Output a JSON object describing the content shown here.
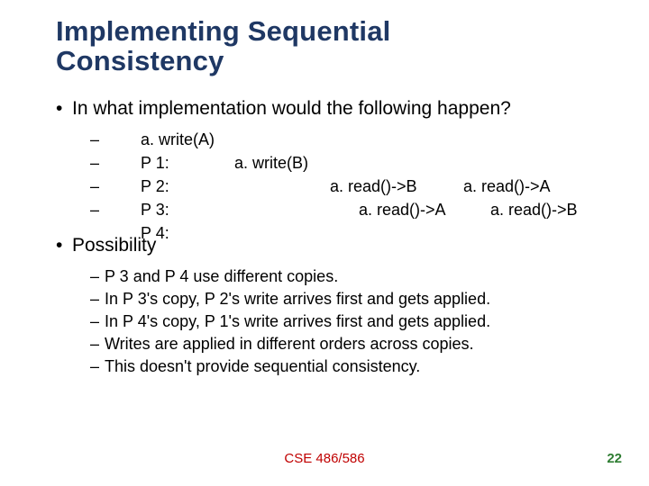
{
  "title_line1": "Implementing Sequential",
  "title_line2": "Consistency",
  "bullet1": "In what implementation would the following happen?",
  "procs": {
    "p1": {
      "label": "P 1:",
      "e0": "a. write(A)"
    },
    "p2": {
      "label": "P 2:",
      "e1": "a. write(B)"
    },
    "p3": {
      "label": "P 3:",
      "e2": "a. read()->B",
      "e3": "a. read()->A"
    },
    "p4": {
      "label": "P 4:",
      "e2b": "a. read()->A",
      "e3b": "a. read()->B"
    }
  },
  "bullet2": "Possibility",
  "subs": [
    "P 3 and P 4 use different copies.",
    "In P 3's copy, P 2's write arrives first and gets applied.",
    "In P 4's copy, P 1's write arrives first and gets applied.",
    "Writes are applied in different orders across copies.",
    "This doesn't provide sequential consistency."
  ],
  "footer_center": "CSE 486/586",
  "footer_num": "22"
}
